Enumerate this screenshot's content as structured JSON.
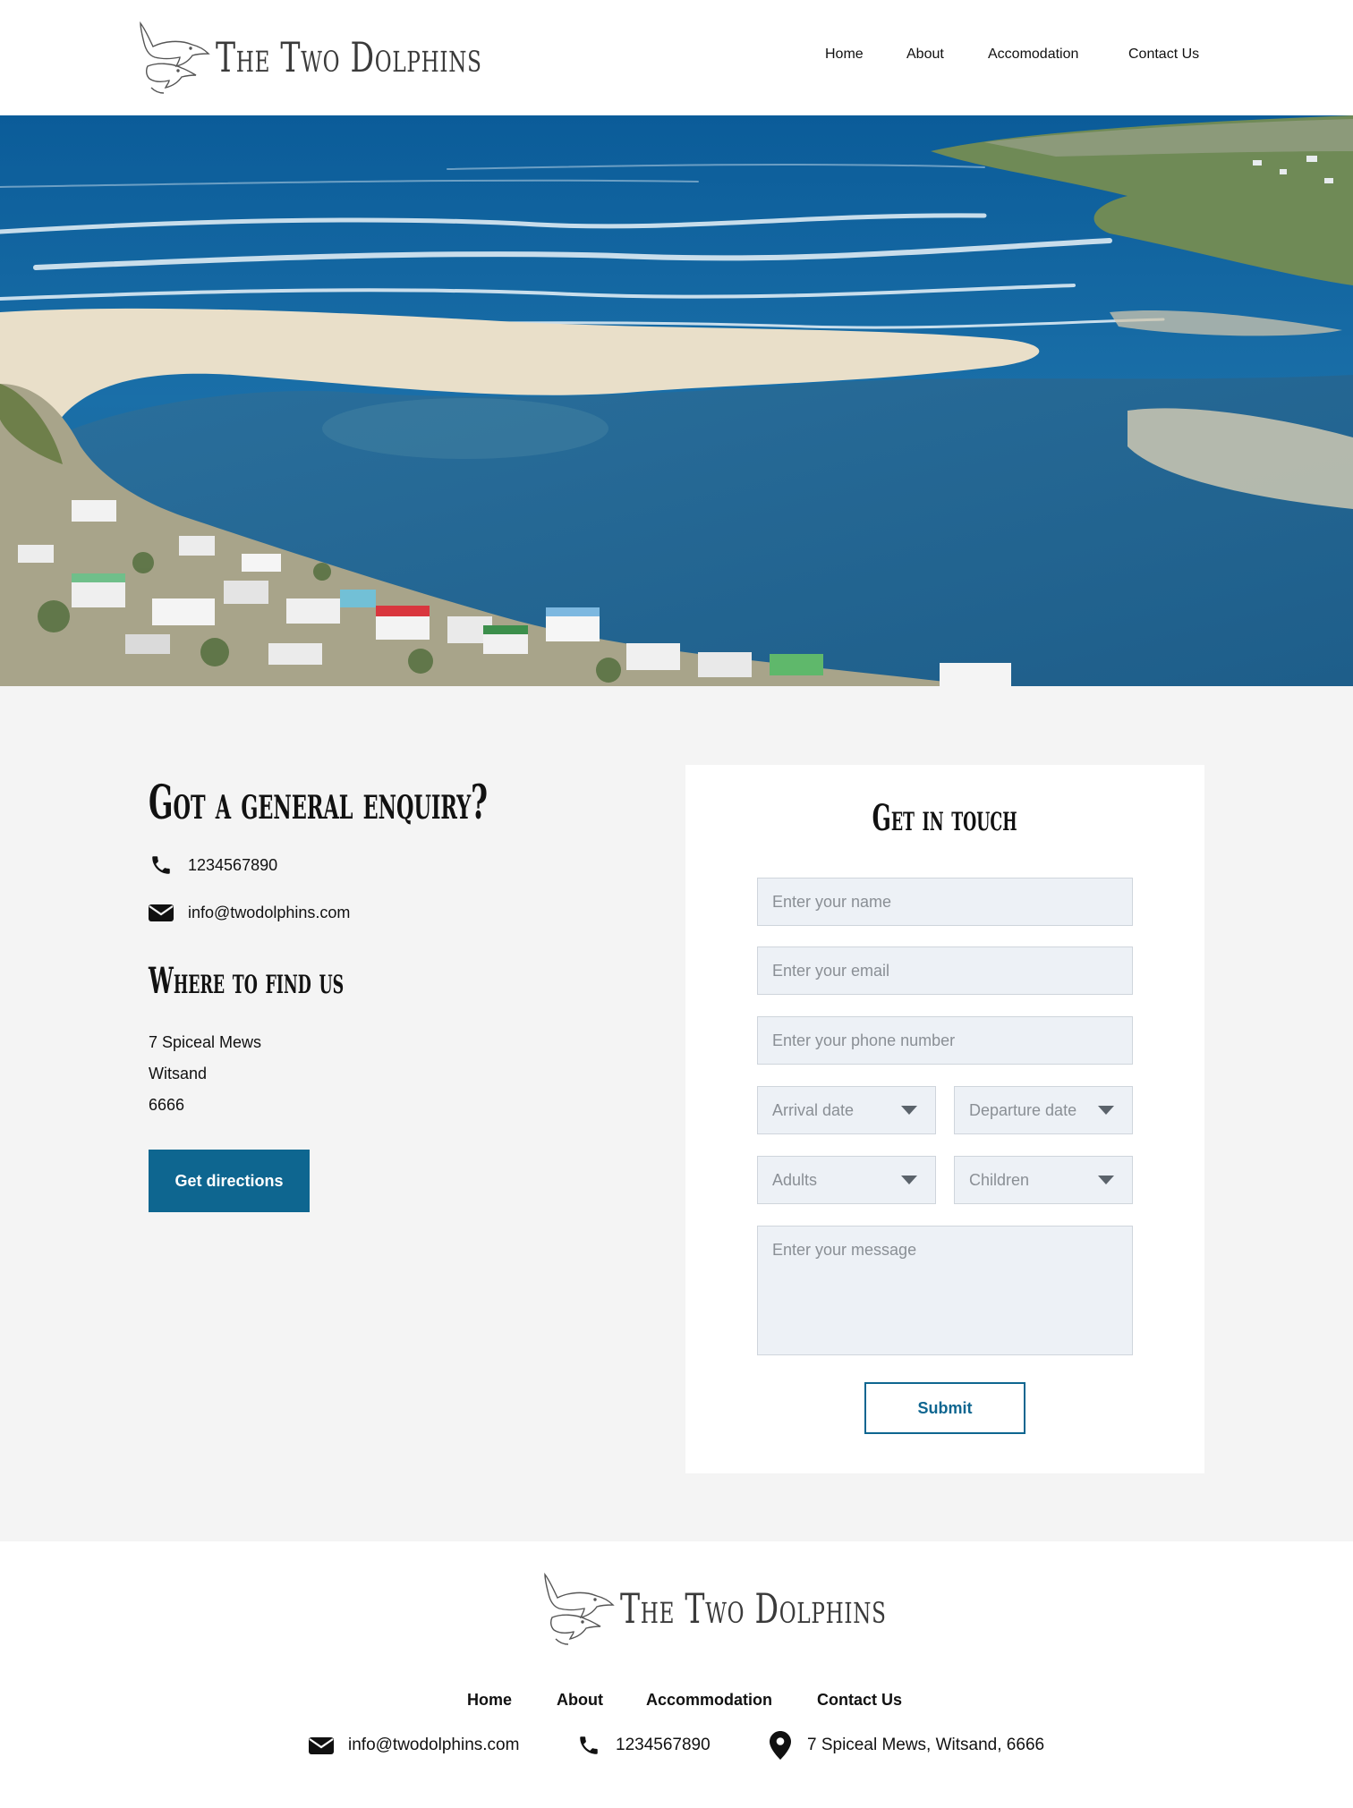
{
  "brand": {
    "name": "The Two Dolphins"
  },
  "nav": {
    "items": [
      "Home",
      "About",
      "Accomodation",
      "Contact Us"
    ]
  },
  "hero": {
    "image": "aerial-view-river-mouth-beach-town"
  },
  "enquiry": {
    "title": "Got a general enquiry?",
    "phone": "1234567890",
    "email": "info@twodolphins.com",
    "find_title": "Where to find us",
    "address": [
      "7 Spiceal Mews",
      "Witsand",
      "6666"
    ],
    "directions_label": "Get directions"
  },
  "form": {
    "title": "Get in touch",
    "name_placeholder": "Enter your name",
    "email_placeholder": "Enter your email",
    "phone_placeholder": "Enter your phone number",
    "arrival_label": "Arrival date",
    "departure_label": "Departure date",
    "adults_label": "Adults",
    "children_label": "Children",
    "message_placeholder": "Enter your message",
    "submit_label": "Submit"
  },
  "footer": {
    "nav": [
      "Home",
      "About",
      "Accommodation",
      "Contact Us"
    ],
    "email": "info@twodolphins.com",
    "phone": "1234567890",
    "address": "7 Spiceal Mews, Witsand, 6666"
  },
  "colors": {
    "accent": "#0e6690",
    "section_bg": "#f4f4f4",
    "field_bg": "#edf1f6"
  },
  "icons": {
    "phone": "phone-icon",
    "email": "envelope-icon",
    "location": "map-pin-icon"
  }
}
